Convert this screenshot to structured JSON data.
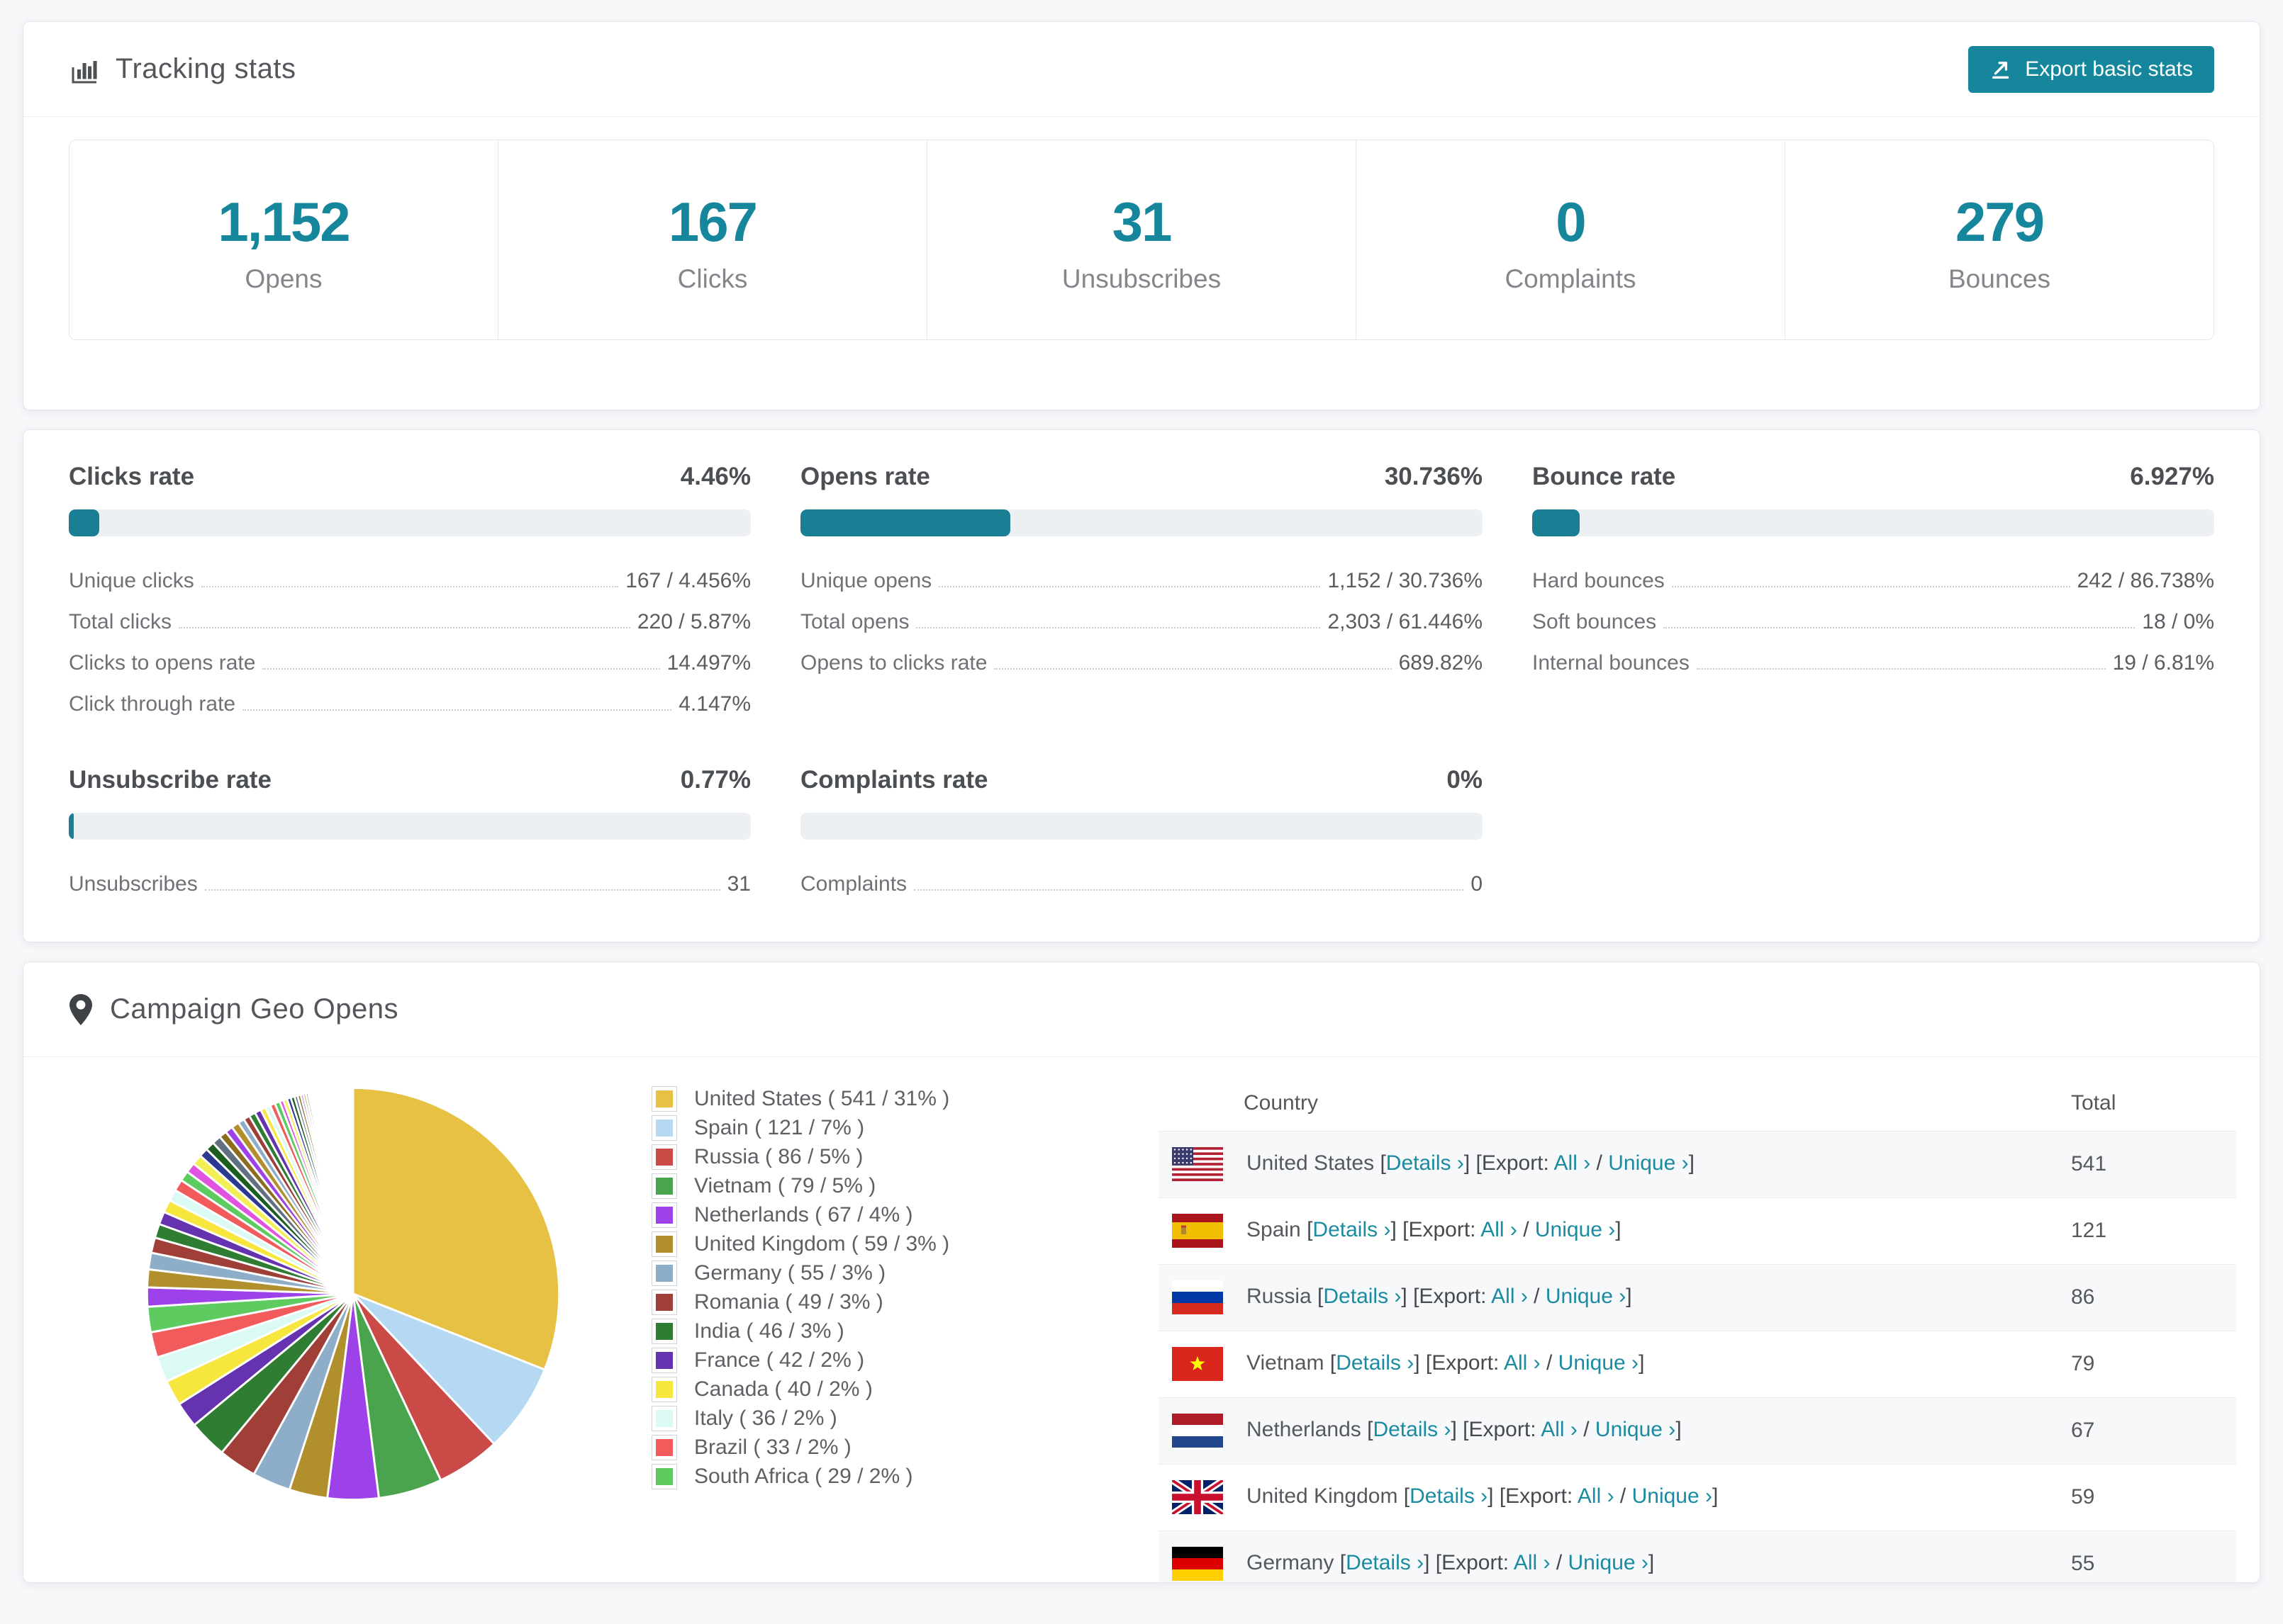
{
  "accent": "#16869c",
  "tracking": {
    "icon": "bar-chart-icon",
    "title": "Tracking stats",
    "export_label": "Export basic stats",
    "stats": [
      {
        "value": "1,152",
        "label": "Opens"
      },
      {
        "value": "167",
        "label": "Clicks"
      },
      {
        "value": "31",
        "label": "Unsubscribes"
      },
      {
        "value": "0",
        "label": "Complaints"
      },
      {
        "value": "279",
        "label": "Bounces"
      }
    ]
  },
  "rates": {
    "sections": [
      {
        "title": "Clicks rate",
        "value": "4.46%",
        "percent": 4.46,
        "rows": [
          [
            "Unique clicks",
            "167 / 4.456%"
          ],
          [
            "Total clicks",
            "220 / 5.87%"
          ],
          [
            "Clicks to opens rate",
            "14.497%"
          ],
          [
            "Click through rate",
            "4.147%"
          ]
        ]
      },
      {
        "title": "Opens rate",
        "value": "30.736%",
        "percent": 30.736,
        "rows": [
          [
            "Unique opens",
            "1,152 / 30.736%"
          ],
          [
            "Total opens",
            "2,303 / 61.446%"
          ],
          [
            "Opens to clicks rate",
            "689.82%"
          ]
        ]
      },
      {
        "title": "Bounce rate",
        "value": "6.927%",
        "percent": 6.927,
        "rows": [
          [
            "Hard bounces",
            "242 / 86.738%"
          ],
          [
            "Soft bounces",
            "18 / 0%"
          ],
          [
            "Internal bounces",
            "19 / 6.81%"
          ]
        ]
      },
      {
        "title": "Unsubscribe rate",
        "value": "0.77%",
        "percent": 0.77,
        "rows": [
          [
            "Unsubscribes",
            "31"
          ]
        ]
      },
      {
        "title": "Complaints rate",
        "value": "0%",
        "percent": 0,
        "rows": [
          [
            "Complaints",
            "0"
          ]
        ]
      }
    ]
  },
  "geo": {
    "icon": "map-pin-icon",
    "title": "Campaign Geo Opens",
    "chart_data": {
      "type": "pie",
      "title": "Campaign Geo Opens",
      "start_angle_deg": -90,
      "direction": "clockwise",
      "legend_position": "right",
      "series": [
        {
          "name": "United States",
          "value": 541,
          "pct": 31,
          "color": "#e7c143"
        },
        {
          "name": "Spain",
          "value": 121,
          "pct": 7,
          "color": "#b5d9f3"
        },
        {
          "name": "Russia",
          "value": 86,
          "pct": 5,
          "color": "#c94a47"
        },
        {
          "name": "Vietnam",
          "value": 79,
          "pct": 5,
          "color": "#4aa44d"
        },
        {
          "name": "Netherlands",
          "value": 67,
          "pct": 4,
          "color": "#9d41e8"
        },
        {
          "name": "United Kingdom",
          "value": 59,
          "pct": 3,
          "color": "#b28f2d"
        },
        {
          "name": "Germany",
          "value": 55,
          "pct": 3,
          "color": "#8dadc8"
        },
        {
          "name": "Romania",
          "value": 49,
          "pct": 3,
          "color": "#a03e38"
        },
        {
          "name": "India",
          "value": 46,
          "pct": 3,
          "color": "#2e7d32"
        },
        {
          "name": "France",
          "value": 42,
          "pct": 2,
          "color": "#6633b0"
        },
        {
          "name": "Canada",
          "value": 40,
          "pct": 2,
          "color": "#f7e63d"
        },
        {
          "name": "Italy",
          "value": 36,
          "pct": 2,
          "color": "#dcfaf4"
        },
        {
          "name": "Brazil",
          "value": 33,
          "pct": 2,
          "color": "#f15b5b"
        },
        {
          "name": "South Africa",
          "value": 29,
          "pct": 2,
          "color": "#5ecb61"
        }
      ],
      "others": {
        "pcts": [
          1.5,
          1.4,
          1.3,
          1.2,
          1.1,
          1.0,
          1.0,
          0.9,
          0.9,
          0.8,
          0.8,
          0.8,
          0.7,
          0.7,
          0.7,
          0.6,
          0.6,
          0.6,
          0.5,
          0.5,
          0.5,
          0.5,
          0.4,
          0.4,
          0.4,
          0.4,
          0.3,
          0.3,
          0.3,
          0.3,
          0.25,
          0.25,
          0.2,
          0.2,
          0.2,
          0.15,
          0.15,
          0.1,
          0.1,
          0.1,
          0.08,
          0.08,
          0.06,
          0.06,
          0.05,
          0.05,
          0.04,
          0.04,
          0.03,
          0.03
        ],
        "palette": [
          "#9d41e8",
          "#b28f2d",
          "#8dadc8",
          "#a03e38",
          "#2e7d32",
          "#6633b0",
          "#f7e63d",
          "#dcfaf4",
          "#f15b5b",
          "#5ecb61",
          "#e052e0",
          "#f2ef55",
          "#2b3990",
          "#1b5e20",
          "#607080",
          "#8c6d1f"
        ]
      }
    },
    "table": {
      "headers": [
        "Country",
        "Total"
      ],
      "links": {
        "details": "Details",
        "export": "Export:",
        "all": "All",
        "unique": "Unique",
        "chevron": "›"
      },
      "rows": [
        {
          "country": "United States",
          "flag": "us",
          "total": "541"
        },
        {
          "country": "Spain",
          "flag": "es",
          "total": "121"
        },
        {
          "country": "Russia",
          "flag": "ru",
          "total": "86"
        },
        {
          "country": "Vietnam",
          "flag": "vn",
          "total": "79"
        },
        {
          "country": "Netherlands",
          "flag": "nl",
          "total": "67"
        },
        {
          "country": "United Kingdom",
          "flag": "gb",
          "total": "59"
        },
        {
          "country": "Germany",
          "flag": "de",
          "total": "55"
        }
      ]
    }
  }
}
